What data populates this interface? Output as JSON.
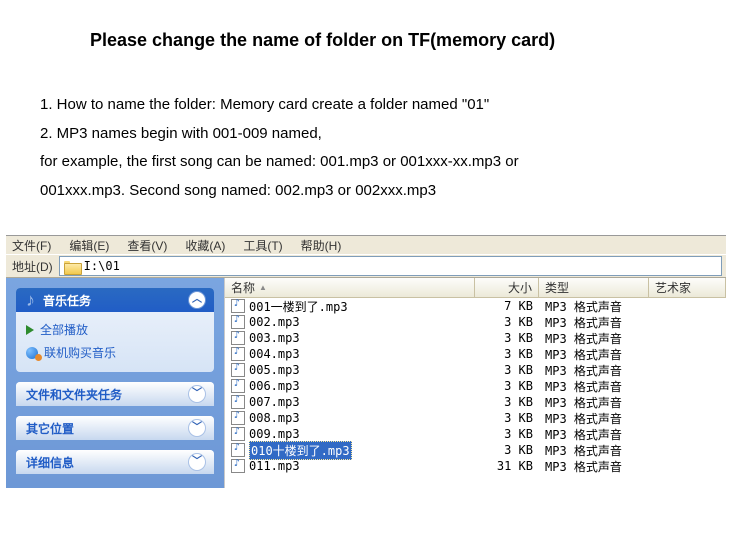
{
  "heading": "Please change the name of folder on TF(memory card)",
  "instructions": [
    "1. How to name the folder: Memory card create a folder named \"01\"",
    "2. MP3 names begin with 001-009 named,",
    "for example, the first song can be named: 001.mp3 or 001xxx-xx.mp3 or",
    "001xxx.mp3. Second song named: 002.mp3 or 002xxx.mp3"
  ],
  "menubar": {
    "file": "文件(F)",
    "edit": "编辑(E)",
    "view": "查看(V)",
    "fav": "收藏(A)",
    "tools": "工具(T)",
    "help": "帮助(H)"
  },
  "address": {
    "label": "地址(D)",
    "value": "I:\\01"
  },
  "sidebar": {
    "music": {
      "title": "音乐任务",
      "playall": "全部播放",
      "shop": "联机购买音乐"
    },
    "filefolder": {
      "title": "文件和文件夹任务"
    },
    "other": {
      "title": "其它位置"
    },
    "details": {
      "title": "详细信息"
    }
  },
  "columns": {
    "name": "名称",
    "size": "大小",
    "type": "类型",
    "artist": "艺术家"
  },
  "type_label": "MP3 格式声音",
  "files": [
    {
      "name": "001一楼到了.mp3",
      "size": "7 KB",
      "selected": false
    },
    {
      "name": "002.mp3",
      "size": "3 KB",
      "selected": false
    },
    {
      "name": "003.mp3",
      "size": "3 KB",
      "selected": false
    },
    {
      "name": "004.mp3",
      "size": "3 KB",
      "selected": false
    },
    {
      "name": "005.mp3",
      "size": "3 KB",
      "selected": false
    },
    {
      "name": "006.mp3",
      "size": "3 KB",
      "selected": false
    },
    {
      "name": "007.mp3",
      "size": "3 KB",
      "selected": false
    },
    {
      "name": "008.mp3",
      "size": "3 KB",
      "selected": false
    },
    {
      "name": "009.mp3",
      "size": "3 KB",
      "selected": false
    },
    {
      "name": "010十楼到了.mp3",
      "size": "3 KB",
      "selected": true
    },
    {
      "name": "011.mp3",
      "size": "31 KB",
      "selected": false
    }
  ]
}
